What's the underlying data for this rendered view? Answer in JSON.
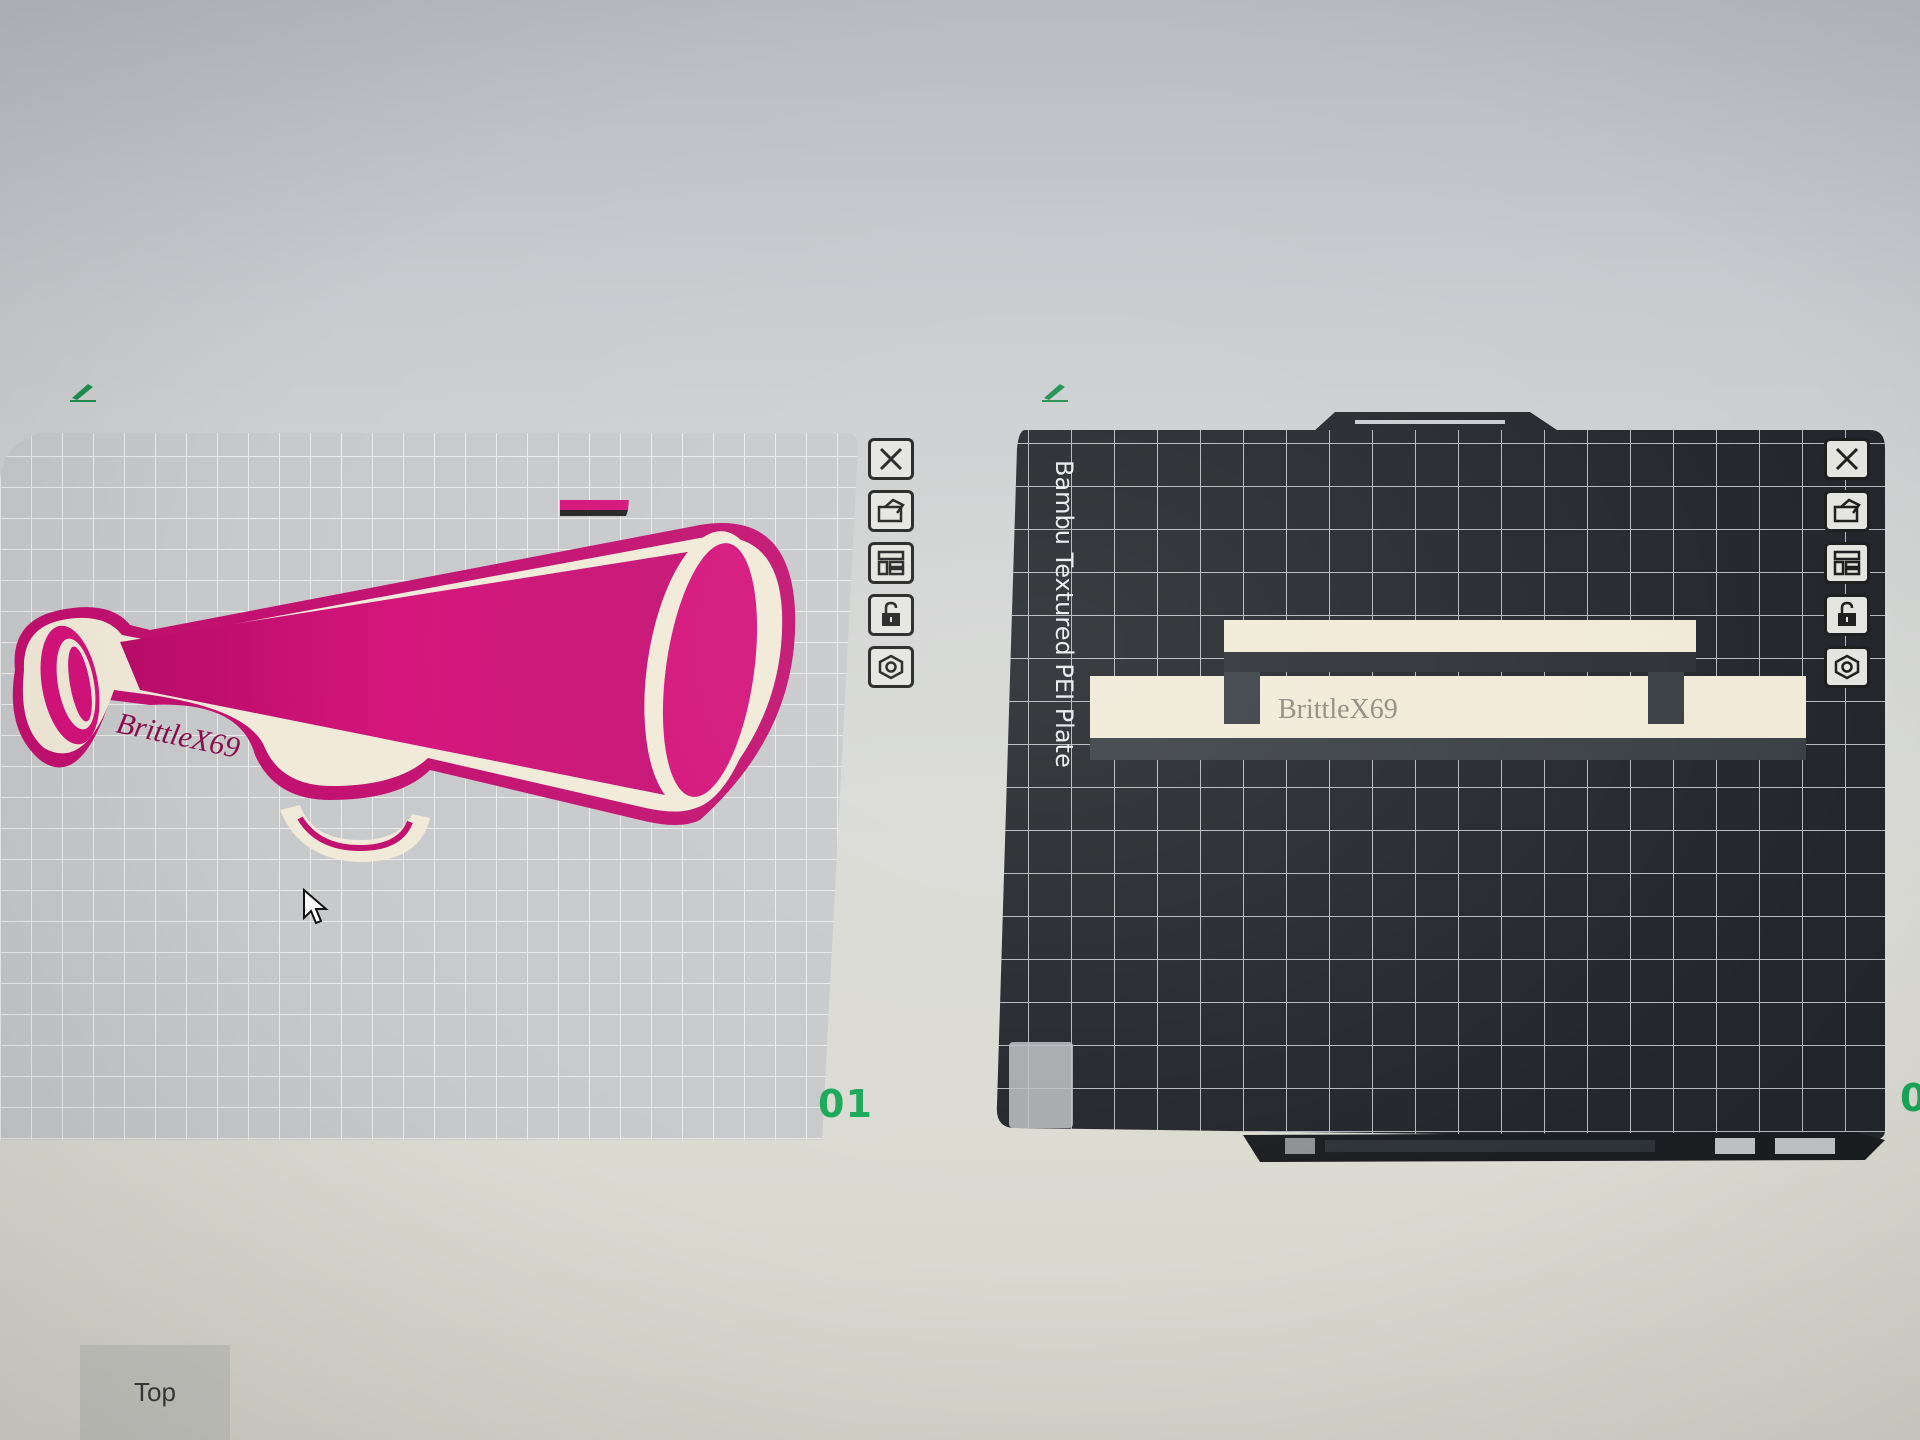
{
  "plates": [
    {
      "number": "01",
      "model_label": "BrittleX69",
      "tools": [
        "close-icon",
        "auto-orient-icon",
        "arrange-icon",
        "lock-icon",
        "settings-icon"
      ]
    },
    {
      "number": "0",
      "plate_type": "Bambu Textured PEI Plate",
      "model_label": "BrittleX69",
      "tools": [
        "close-icon",
        "auto-orient-icon",
        "arrange-icon",
        "lock-icon",
        "settings-icon"
      ]
    }
  ],
  "view": {
    "label": "Top"
  },
  "colors": {
    "model_pink": "#d4127a",
    "model_cream": "#f1ead8",
    "plate_dark": "#23272b",
    "plate_light": "#bfc2c4",
    "plate_number": "#1aa85a",
    "edit_icon": "#1f8f4f"
  }
}
